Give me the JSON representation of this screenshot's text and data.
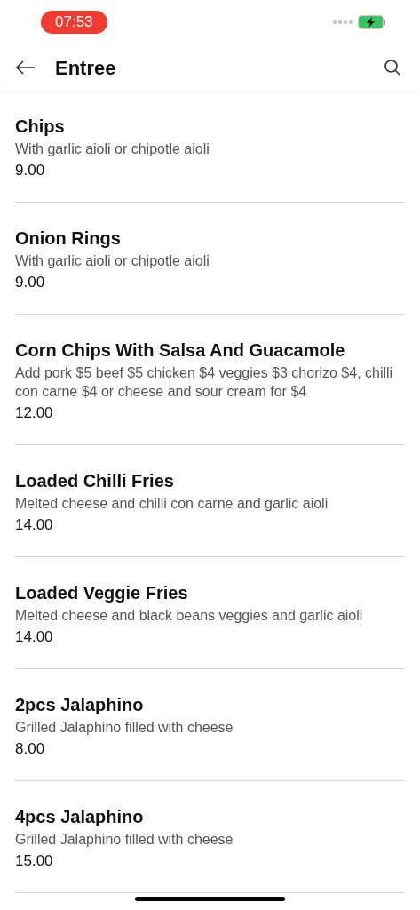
{
  "status_bar": {
    "time": "07:53"
  },
  "header": {
    "title": "Entree"
  },
  "items": [
    {
      "name": "Chips",
      "description": "With garlic aioli or chipotle aioli",
      "price": "9.00"
    },
    {
      "name": "Onion Rings",
      "description": "With garlic aioli or chipotle aioli",
      "price": "9.00"
    },
    {
      "name": "Corn Chips With Salsa And Guacamole",
      "description": "Add pork $5 beef $5 chicken $4 veggies $3 chorizo $4, chilli con carne $4 or cheese and sour cream for $4",
      "price": "12.00"
    },
    {
      "name": "Loaded Chilli Fries",
      "description": "Melted cheese and chilli con carne and garlic aioli",
      "price": "14.00"
    },
    {
      "name": "Loaded Veggie Fries",
      "description": "Melted cheese and black beans veggies and garlic aioli",
      "price": "14.00"
    },
    {
      "name": "2pcs Jalaphino",
      "description": "Grilled Jalaphino filled with cheese",
      "price": "8.00"
    },
    {
      "name": "4pcs Jalaphino",
      "description": "Grilled Jalaphino filled with cheese",
      "price": "15.00"
    }
  ]
}
